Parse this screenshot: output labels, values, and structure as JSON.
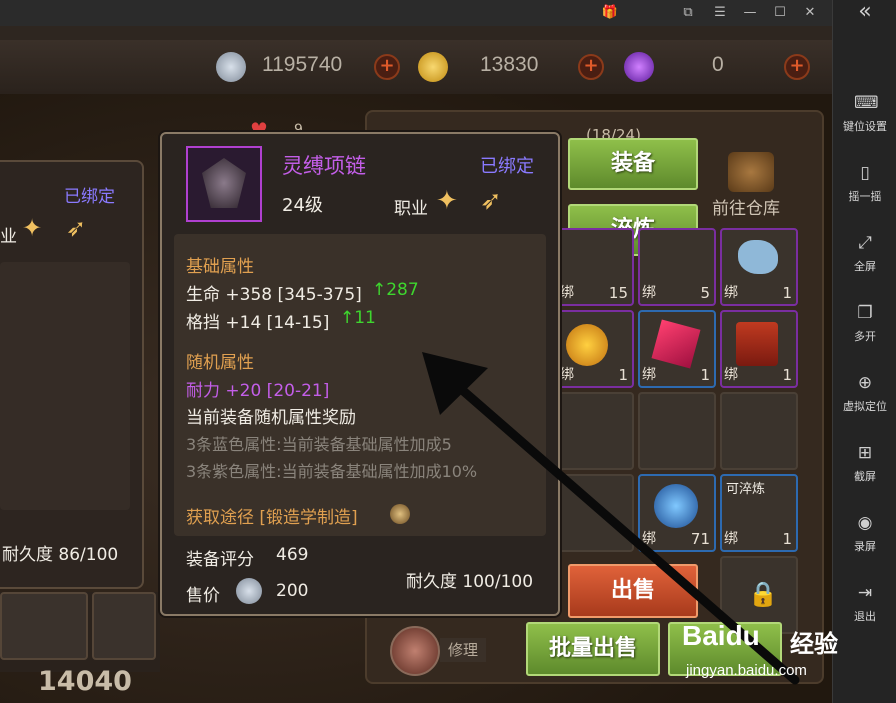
{
  "window": {
    "minimize": "—",
    "menu": "☰",
    "maximize": "☐",
    "close": "✕",
    "collapse": "«"
  },
  "side_panel": [
    {
      "label": "键位设置",
      "icon": "keyboard-icon",
      "glyph": "⌨"
    },
    {
      "label": "摇一摇",
      "icon": "shake-icon",
      "glyph": "▯"
    },
    {
      "label": "全屏",
      "icon": "fullscreen-icon",
      "glyph": "⤢"
    },
    {
      "label": "多开",
      "icon": "multi-open-icon",
      "glyph": "❐"
    },
    {
      "label": "虚拟定位",
      "icon": "location-icon",
      "glyph": "⊕"
    },
    {
      "label": "截屏",
      "icon": "screenshot-icon",
      "glyph": "⊞"
    },
    {
      "label": "录屏",
      "icon": "record-icon",
      "glyph": "◉"
    },
    {
      "label": "退出",
      "icon": "exit-icon",
      "glyph": "⇥"
    }
  ],
  "currency": {
    "silver": "1195740",
    "gold": "13830",
    "gem": "0"
  },
  "left_panel": {
    "bound": "已绑定",
    "job": "业",
    "durability": "耐久度 86/100",
    "score": "14040"
  },
  "inventory": {
    "hp_count": "9",
    "capacity": "(18/24)",
    "equip_btn": "装备",
    "refine_btn": "淬炼",
    "warehouse": "前往仓库",
    "sell_btn": "出售",
    "batch_sell": "批量出售",
    "repair": "修理",
    "bind_tag": "绑",
    "refinable": "可淬炼",
    "counts": [
      "15",
      "5",
      "1",
      "1",
      "1",
      "1",
      "71",
      "1"
    ]
  },
  "tooltip": {
    "name": "灵缚项链",
    "bound": "已绑定",
    "level": "24级",
    "job_label": "职业",
    "base_title": "基础属性",
    "hp_line": "生命 +358 [345-375]",
    "hp_up": "↑287",
    "block_line": "格挡 +14 [14-15]",
    "block_up": "↑11",
    "random_title": "随机属性",
    "stamina_line": "耐力 +20 [20-21]",
    "reward_title": "当前装备随机属性奖励",
    "blue_reward": "3条蓝色属性:当前装备基础属性加成5",
    "purple_reward": "3条紫色属性:当前装备基础属性加成10%",
    "source": "获取途径 [锻造学制造]",
    "score_label": "装备评分",
    "score_value": "469",
    "price_label": "售价",
    "price_value": "200",
    "durability": "耐久度 100/100"
  },
  "watermark": {
    "brand": "Baidu",
    "word": "经验",
    "url": "jingyan.baidu.com"
  },
  "colors": {
    "purple_text": "#c35ee8",
    "green_up": "#3ed62e",
    "orange_title": "#e0a050"
  }
}
